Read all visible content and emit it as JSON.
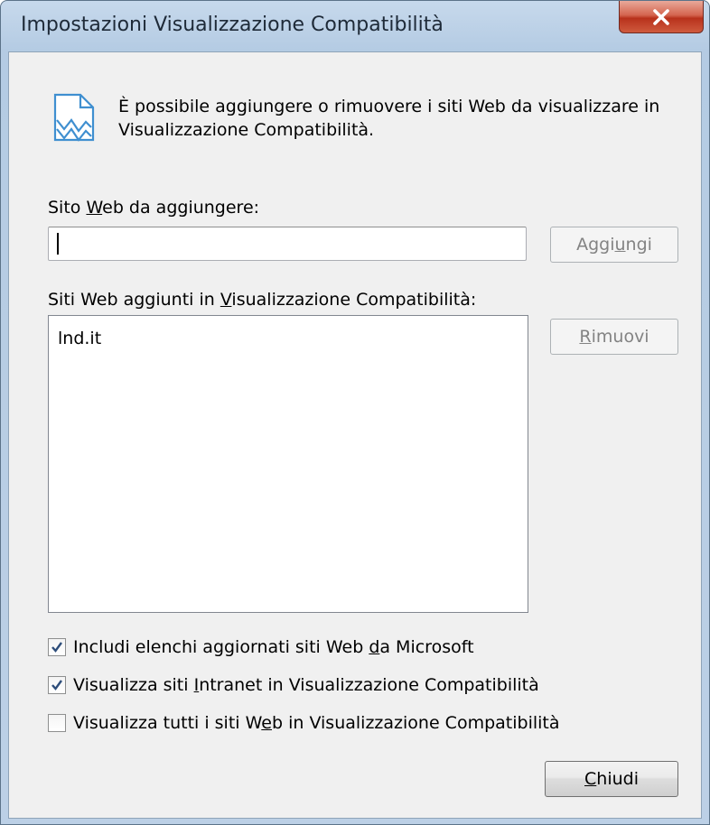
{
  "window": {
    "title": "Impostazioni Visualizzazione Compatibilità",
    "close_glyph": "✕"
  },
  "info": {
    "icon": "compatibility-view-icon",
    "text": "È possibile aggiungere o rimuovere i siti Web da visualizzare in Visualizzazione Compatibilità."
  },
  "add_site": {
    "label_pre": "Sito ",
    "label_key": "W",
    "label_post": "eb da aggiungere:",
    "value": "",
    "button_pre": "Aggi",
    "button_key": "u",
    "button_post": "ngi"
  },
  "sites_list": {
    "label_pre": "Siti Web aggiunti in ",
    "label_key": "V",
    "label_post": "isualizzazione Compatibilità:",
    "items": [
      "lnd.it"
    ],
    "remove_pre": "",
    "remove_key": "R",
    "remove_post": "imuovi"
  },
  "options": [
    {
      "checked": true,
      "pre": "Includi elenchi aggiornati siti Web ",
      "key": "d",
      "post": "a Microsoft"
    },
    {
      "checked": true,
      "pre": "Visualizza siti ",
      "key": "I",
      "post": "ntranet in Visualizzazione Compatibilità"
    },
    {
      "checked": false,
      "pre": "Visualizza tutti i siti W",
      "key": "e",
      "post": "b in Visualizzazione Compatibilità"
    }
  ],
  "close_button": {
    "pre": "",
    "key": "C",
    "post": "hiudi"
  }
}
